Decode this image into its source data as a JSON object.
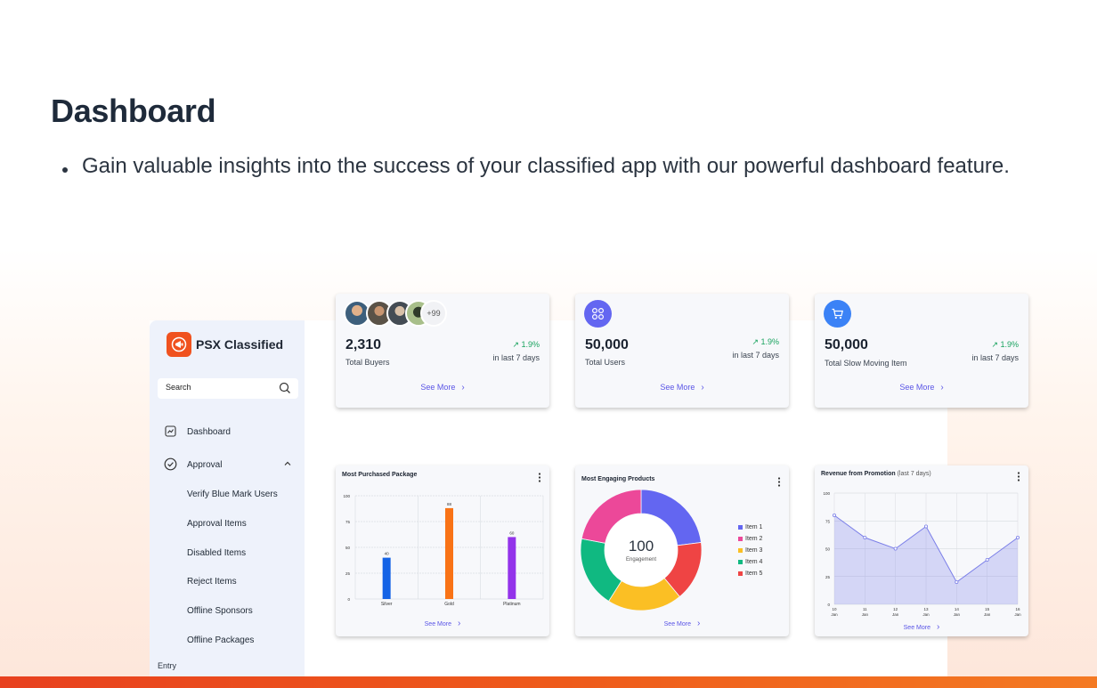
{
  "page": {
    "title": "Dashboard",
    "bullet": "Gain valuable insights into the success of your classified app with our powerful dashboard feature."
  },
  "colors": {
    "accent": "#5a55e6",
    "brand": "#f0521f",
    "positive": "#19a35f"
  },
  "app": {
    "brand": "PSX Classified",
    "logo_icon": "megaphone-icon",
    "search": {
      "placeholder": "Search"
    },
    "nav": [
      {
        "label": "Dashboard",
        "icon": "chart-line-icon"
      },
      {
        "label": "Approval",
        "icon": "check-circle-icon",
        "expanded": true
      }
    ],
    "approval_subitems": [
      "Verify Blue Mark Users",
      "Approval Items",
      "Disabled Items",
      "Reject Items",
      "Offline Sponsors",
      "Offline Packages"
    ],
    "section_label": "Entry"
  },
  "stats": [
    {
      "value": "2,310",
      "label": "Total Buyers",
      "change": "↗ 1.9%",
      "period": "in last 7 days",
      "see_more": "See More",
      "avatar_more": "+99"
    },
    {
      "value": "50,000",
      "label": "Total Users",
      "change": "↗ 1.9%",
      "period": "in last 7 days",
      "see_more": "See More",
      "icon": "grid-icon",
      "icon_color": "#6366f1"
    },
    {
      "value": "50,000",
      "label": "Total Slow Moving Item",
      "change": "↗ 1.9%",
      "period": "in last 7 days",
      "see_more": "See More",
      "icon": "cart-icon",
      "icon_color": "#3b82f6"
    }
  ],
  "charts": {
    "bar": {
      "title": "Most Purchased Package",
      "see_more": "See More"
    },
    "donut": {
      "title": "Most Engaging Products",
      "center_value": "100",
      "center_label": "Engagement",
      "see_more": "See More"
    },
    "line": {
      "title": "Revenue from Promotion",
      "title_note": "(last 7 days)",
      "see_more": "See More"
    }
  },
  "chart_data": [
    {
      "type": "bar",
      "title": "Most Purchased Package",
      "categories": [
        "Silver",
        "Gold",
        "Platinum"
      ],
      "values": [
        40,
        88,
        60
      ],
      "colors": [
        "#1463e6",
        "#f97316",
        "#9333ea"
      ],
      "ylim": [
        0,
        100
      ],
      "yticks": [
        0,
        25,
        50,
        75,
        100
      ],
      "grid": true
    },
    {
      "type": "pie",
      "title": "Most Engaging Products",
      "categories": [
        "Item 1",
        "Item 2",
        "Item 3",
        "Item 4",
        "Item 5"
      ],
      "values": [
        23,
        22,
        20,
        19,
        16
      ],
      "slice_order": [
        "Item 1",
        "Item 5",
        "Item 3",
        "Item 4",
        "Item 2"
      ],
      "colors": {
        "Item 1": "#6366f1",
        "Item 2": "#ec4899",
        "Item 3": "#fbbf24",
        "Item 4": "#10b981",
        "Item 5": "#ef4444"
      },
      "legend": "right"
    },
    {
      "type": "area",
      "title": "Revenue from Promotion",
      "x": [
        "10 Jan",
        "11 Jan",
        "12 Jan",
        "13 Jan",
        "14 Jan",
        "15 Jan",
        "16 Jan"
      ],
      "x_day": [
        "10",
        "11",
        "12",
        "13",
        "14",
        "15",
        "16"
      ],
      "x_month": "Jan",
      "values": [
        80,
        60,
        50,
        70,
        20,
        40,
        60
      ],
      "ylim": [
        0,
        100
      ],
      "yticks": [
        0,
        25,
        50,
        75,
        100
      ],
      "color": "#7b7fe8",
      "grid": true
    }
  ]
}
